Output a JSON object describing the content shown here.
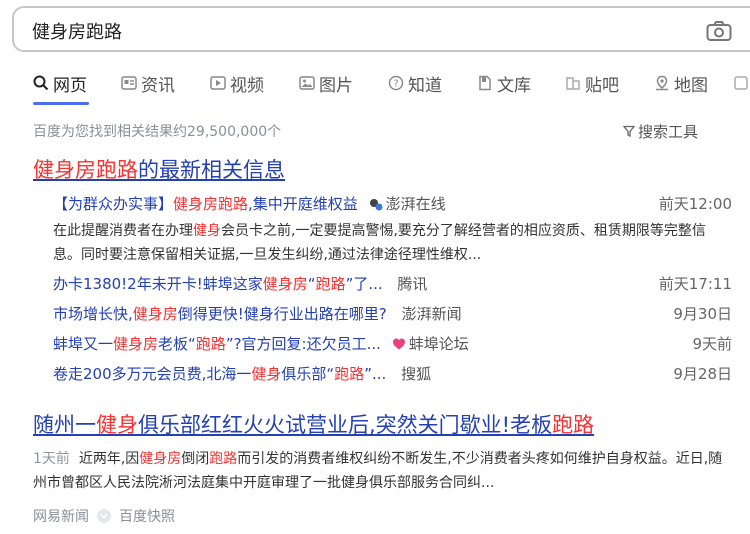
{
  "search": {
    "query": "健身房跑路"
  },
  "tabs": [
    {
      "label": "网页",
      "icon": "search-icon"
    },
    {
      "label": "资讯",
      "icon": "news-icon"
    },
    {
      "label": "视频",
      "icon": "video-icon"
    },
    {
      "label": "图片",
      "icon": "image-icon"
    },
    {
      "label": "知道",
      "icon": "question-icon"
    },
    {
      "label": "文库",
      "icon": "document-icon"
    },
    {
      "label": "贴吧",
      "icon": "tieba-icon"
    },
    {
      "label": "地图",
      "icon": "map-icon"
    }
  ],
  "result_count": "百度为您找到相关结果约29,500,000个",
  "search_tools": "搜索工具",
  "news_block": {
    "title_red": "健身房跑路",
    "title_rest": "的最新相关信息",
    "items": [
      {
        "pre": "【为群众办实事】",
        "red": "健身房跑路",
        "post": ",集中开庭维权益",
        "source": "澎湃在线",
        "time": "前天12:00"
      },
      {
        "pre": "办卡1380!2年未开卡!蚌埠这家",
        "red": "健身房",
        "mid": "“",
        "red2": "跑路",
        "post": "”了...",
        "source": "腾讯",
        "time": "前天17:11"
      },
      {
        "pre": "市场增长快,",
        "red": "健身房",
        "post": "倒得更快!健身行业出路在哪里?",
        "source": "澎湃新闻",
        "time": "9月30日"
      },
      {
        "pre": "蚌埠又一",
        "red": "健身房",
        "mid": "老板“",
        "red2": "跑路",
        "post": "”?官方回复:还欠员工...",
        "source": "蚌埠论坛",
        "time": "9天前"
      },
      {
        "pre": "卷走200多万元会员费,北海一",
        "red": "健身",
        "mid": "俱乐部“",
        "red2": "跑路",
        "post": "”...",
        "source": "搜狐",
        "time": "9月28日"
      }
    ],
    "snippet": {
      "a": "在此提醒消费者在办理",
      "red": "健身",
      "b": "会员卡之前,一定要提高警惕,要充分了解经营者的相应资质、租赁期限等完整信息。同时要注意保留相关证据,一旦发生纠纷,通过法律途径理性维权..."
    }
  },
  "result2": {
    "t1": "随州一",
    "t2": "健身",
    "t3": "俱乐部红红火火试营业后,突然关门歇业!老板",
    "t4": "跑路",
    "day": "1天前",
    "s1": "近两年,因",
    "s2": "健身房",
    "s3": "倒闭",
    "s4": "跑路",
    "s5": "而引发的消费者维权纠纷不断发生,不少消费者头疼如何维护自身权益。近日,随州市曾都区人民法院淅河法庭集中开庭审理了一批健身俱乐部服务合同纠...",
    "source": "网易新闻",
    "snapshot": "百度快照"
  },
  "colors": {
    "link": "#2440b3",
    "highlight": "#f73131",
    "accent": "#4e6ef2"
  }
}
